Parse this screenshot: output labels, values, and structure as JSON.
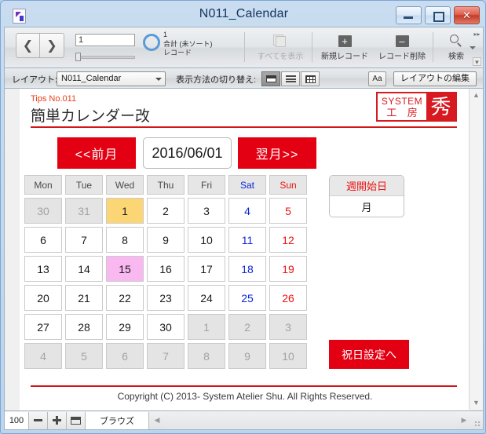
{
  "window": {
    "title": "N011_Calendar",
    "app_icon": "filemaker-document-icon",
    "controls": {
      "minimize": "–",
      "maximize": "❐",
      "close": "✕"
    }
  },
  "toolbar": {
    "prev_record_icon": "chevron-left-icon",
    "next_record_icon": "chevron-right-icon",
    "record_number": "1",
    "record_count": "1",
    "record_sort_state": "合計 (未ソート)",
    "record_word": "レコード",
    "buttons": [
      {
        "label": "すべてを表示",
        "icon": "show-all-records-icon",
        "disabled": true
      },
      {
        "label": "新規レコード",
        "icon": "plus-square-icon",
        "glyph": "+",
        "disabled": false
      },
      {
        "label": "レコード削除",
        "icon": "minus-square-icon",
        "glyph": "–",
        "disabled": false
      },
      {
        "label": "検索",
        "icon": "magnifier-icon",
        "disabled": false
      }
    ]
  },
  "layoutbar": {
    "layout_label": "レイアウト:",
    "layout_value": "N011_Calendar",
    "view_switch_label": "表示方法の切り替え:",
    "view_modes": [
      "form-view-icon",
      "list-view-icon",
      "table-view-icon"
    ],
    "active_view_index": 0,
    "text_format_label": "Aa",
    "edit_layout_label": "レイアウトの編集"
  },
  "form": {
    "tips_no": "Tips No.011",
    "title": "簡単カレンダー改",
    "logo": {
      "line1": "SYSTEM",
      "line2": "工 房",
      "mark": "秀"
    },
    "prev_month_label": "<<前月",
    "next_month_label": "翌月>>",
    "date_value": "2016/06/01",
    "week_start": {
      "header": "週開始日",
      "value": "月"
    },
    "holiday_button_label": "祝日設定へ",
    "copyright": "Copyright (C) 2013- System Atelier Shu. All Rights Reserved."
  },
  "calendar": {
    "weekday_headers": [
      {
        "label": "Mon",
        "kind": "weekday"
      },
      {
        "label": "Tue",
        "kind": "weekday"
      },
      {
        "label": "Wed",
        "kind": "weekday"
      },
      {
        "label": "Thu",
        "kind": "weekday"
      },
      {
        "label": "Fri",
        "kind": "weekday"
      },
      {
        "label": "Sat",
        "kind": "sat"
      },
      {
        "label": "Sun",
        "kind": "sun"
      }
    ],
    "colors": {
      "today_highlight": "#fcd575",
      "selected_highlight": "#f9b8f0",
      "out_of_month": "#e4e4e4",
      "saturday_text": "#0b27d6",
      "sunday_text": "#ee1111",
      "accent_red": "#e30012"
    },
    "weeks": [
      [
        {
          "day": "30",
          "kind": "weekday",
          "out": true,
          "state": ""
        },
        {
          "day": "31",
          "kind": "weekday",
          "out": true,
          "state": ""
        },
        {
          "day": "1",
          "kind": "weekday",
          "out": false,
          "state": "today"
        },
        {
          "day": "2",
          "kind": "weekday",
          "out": false,
          "state": ""
        },
        {
          "day": "3",
          "kind": "weekday",
          "out": false,
          "state": ""
        },
        {
          "day": "4",
          "kind": "sat",
          "out": false,
          "state": ""
        },
        {
          "day": "5",
          "kind": "sun",
          "out": false,
          "state": ""
        }
      ],
      [
        {
          "day": "6",
          "kind": "weekday",
          "out": false,
          "state": ""
        },
        {
          "day": "7",
          "kind": "weekday",
          "out": false,
          "state": ""
        },
        {
          "day": "8",
          "kind": "weekday",
          "out": false,
          "state": ""
        },
        {
          "day": "9",
          "kind": "weekday",
          "out": false,
          "state": ""
        },
        {
          "day": "10",
          "kind": "weekday",
          "out": false,
          "state": ""
        },
        {
          "day": "11",
          "kind": "sat",
          "out": false,
          "state": ""
        },
        {
          "day": "12",
          "kind": "sun",
          "out": false,
          "state": ""
        }
      ],
      [
        {
          "day": "13",
          "kind": "weekday",
          "out": false,
          "state": ""
        },
        {
          "day": "14",
          "kind": "weekday",
          "out": false,
          "state": ""
        },
        {
          "day": "15",
          "kind": "weekday",
          "out": false,
          "state": "sel"
        },
        {
          "day": "16",
          "kind": "weekday",
          "out": false,
          "state": ""
        },
        {
          "day": "17",
          "kind": "weekday",
          "out": false,
          "state": ""
        },
        {
          "day": "18",
          "kind": "sat",
          "out": false,
          "state": ""
        },
        {
          "day": "19",
          "kind": "sun",
          "out": false,
          "state": ""
        }
      ],
      [
        {
          "day": "20",
          "kind": "weekday",
          "out": false,
          "state": ""
        },
        {
          "day": "21",
          "kind": "weekday",
          "out": false,
          "state": ""
        },
        {
          "day": "22",
          "kind": "weekday",
          "out": false,
          "state": ""
        },
        {
          "day": "23",
          "kind": "weekday",
          "out": false,
          "state": ""
        },
        {
          "day": "24",
          "kind": "weekday",
          "out": false,
          "state": ""
        },
        {
          "day": "25",
          "kind": "sat",
          "out": false,
          "state": ""
        },
        {
          "day": "26",
          "kind": "sun",
          "out": false,
          "state": ""
        }
      ],
      [
        {
          "day": "27",
          "kind": "weekday",
          "out": false,
          "state": ""
        },
        {
          "day": "28",
          "kind": "weekday",
          "out": false,
          "state": ""
        },
        {
          "day": "29",
          "kind": "weekday",
          "out": false,
          "state": ""
        },
        {
          "day": "30",
          "kind": "weekday",
          "out": false,
          "state": ""
        },
        {
          "day": "1",
          "kind": "weekday",
          "out": true,
          "state": ""
        },
        {
          "day": "2",
          "kind": "sat",
          "out": true,
          "state": ""
        },
        {
          "day": "3",
          "kind": "sun",
          "out": true,
          "state": ""
        }
      ],
      [
        {
          "day": "4",
          "kind": "weekday",
          "out": true,
          "state": ""
        },
        {
          "day": "5",
          "kind": "weekday",
          "out": true,
          "state": ""
        },
        {
          "day": "6",
          "kind": "weekday",
          "out": true,
          "state": ""
        },
        {
          "day": "7",
          "kind": "weekday",
          "out": true,
          "state": ""
        },
        {
          "day": "8",
          "kind": "weekday",
          "out": true,
          "state": ""
        },
        {
          "day": "9",
          "kind": "sat",
          "out": true,
          "state": ""
        },
        {
          "day": "10",
          "kind": "sun",
          "out": true,
          "state": ""
        }
      ]
    ]
  },
  "statusbar": {
    "zoom_level": "100",
    "zoom_out_icon": "minus-icon",
    "zoom_in_icon": "plus-icon",
    "toggle_window_icon": "window-toggle-icon",
    "mode": "ブラウズ"
  }
}
